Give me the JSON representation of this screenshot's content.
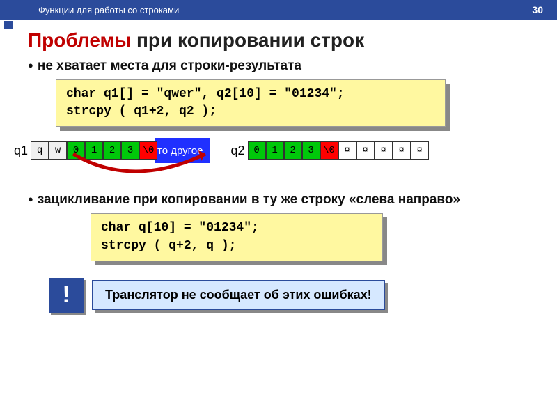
{
  "header": {
    "section": "Функции для работы со строками",
    "page": "30"
  },
  "title": {
    "red": "Проблемы",
    "rest": " при копировании строк"
  },
  "bullet1": "не хватает места для строки-результата",
  "code1": "char q1[] = \"qwer\", q2[10] = \"01234\";\nstrcpy ( q1+2, q2 );",
  "mem": {
    "q1_label": "q1",
    "q1_cells": [
      {
        "v": "q",
        "c": "gray"
      },
      {
        "v": "w",
        "c": "gray"
      },
      {
        "v": "0",
        "c": "green"
      },
      {
        "v": "1",
        "c": "green"
      },
      {
        "v": "2",
        "c": "green"
      },
      {
        "v": "3",
        "c": "green"
      },
      {
        "v": "\\0",
        "c": "red"
      }
    ],
    "blue_note": "то другое",
    "q2_label": "q2",
    "q2_cells": [
      {
        "v": "0",
        "c": "green"
      },
      {
        "v": "1",
        "c": "green"
      },
      {
        "v": "2",
        "c": "green"
      },
      {
        "v": "3",
        "c": "green"
      },
      {
        "v": "\\0",
        "c": "red"
      },
      {
        "v": "¤",
        "c": ""
      },
      {
        "v": "¤",
        "c": ""
      },
      {
        "v": "¤",
        "c": ""
      },
      {
        "v": "¤",
        "c": ""
      },
      {
        "v": "¤",
        "c": ""
      }
    ]
  },
  "bullet2": "зацикливание при копировании в ту же строку «слева направо»",
  "code2": "char q[10] = \"01234\";\nstrcpy ( q+2, q );",
  "warn": {
    "badge": "!",
    "text": "Транслятор не сообщает об этих ошибках!"
  }
}
